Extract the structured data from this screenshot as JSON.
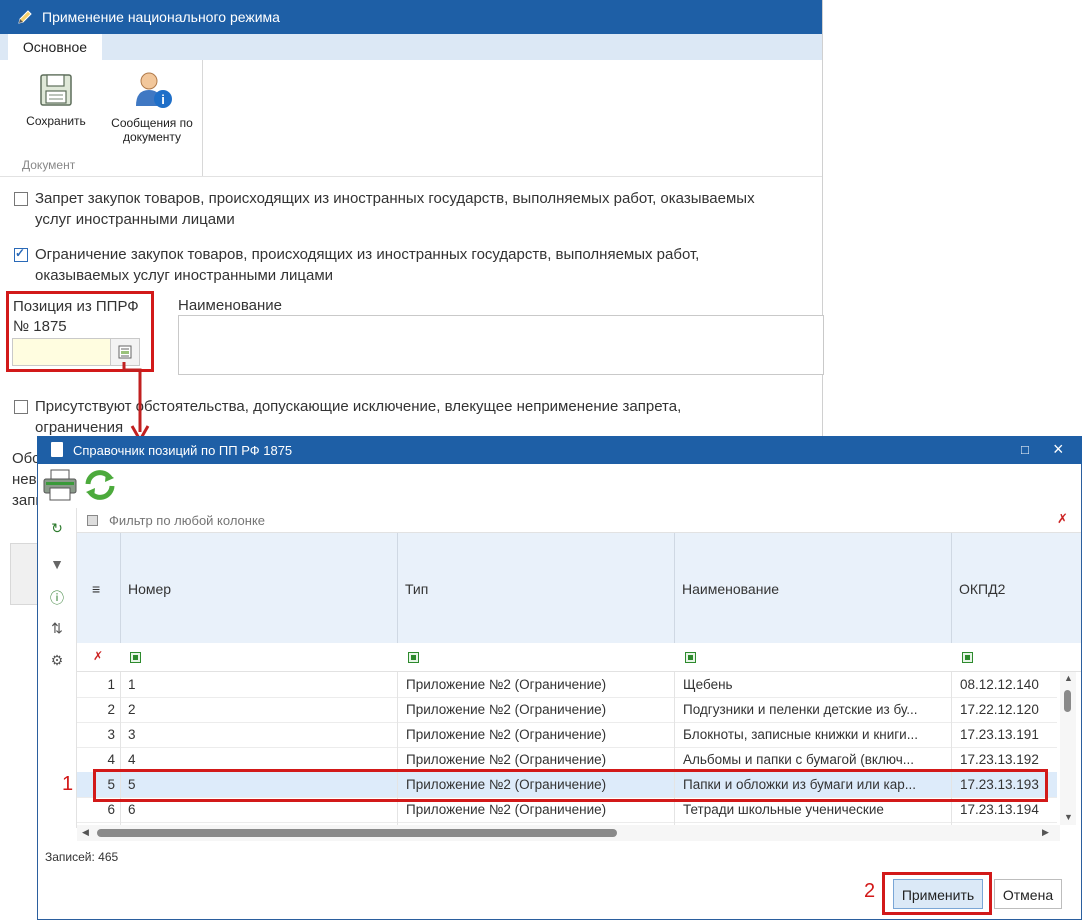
{
  "back_window": {
    "title": "Применение национального режима",
    "tabs": [
      {
        "label": "Основное"
      }
    ],
    "ribbon": {
      "save_label": "Сохранить",
      "messages_label_line1": "Сообщения по",
      "messages_label_line2": "документу",
      "group_label": "Документ"
    },
    "checkboxes": [
      {
        "checked": false,
        "line1": "Запрет закупок товаров, происходящих из иностранных государств, выполняемых работ, оказываемых",
        "line2": "услуг иностранными лицами"
      },
      {
        "checked": true,
        "line1": "Ограничение закупок товаров, происходящих из иностранных государств, выполняемых работ,",
        "line2": "оказываемых услуг иностранными лицами"
      },
      {
        "checked": false,
        "line1": "Присутствуют обстоятельства, допускающие исключение, влекущее неприменение запрета,",
        "line2": "ограничения"
      }
    ],
    "position_label_line1": "Позиция из ППРФ",
    "position_label_line2": "№ 1875",
    "position_value": "",
    "name_label": "Наименование",
    "name_value": "",
    "fragment_lines": [
      "Обс",
      "нев",
      "запи"
    ]
  },
  "dialog": {
    "title": "Справочник позиций по ПП РФ 1875",
    "filter_placeholder": "Фильтр по любой колонке",
    "columns": [
      "Номер",
      "Тип",
      "Наименование",
      "ОКПД2"
    ],
    "rows": [
      {
        "idx": "1",
        "num": "1",
        "type": "Приложение №2 (Ограничение)",
        "name": "Щебень",
        "okpd": "08.12.12.140"
      },
      {
        "idx": "2",
        "num": "2",
        "type": "Приложение №2 (Ограничение)",
        "name": "Подгузники и пеленки детские из бу...",
        "okpd": "17.22.12.120"
      },
      {
        "idx": "3",
        "num": "3",
        "type": "Приложение №2 (Ограничение)",
        "name": "Блокноты, записные книжки и книги...",
        "okpd": "17.23.13.191"
      },
      {
        "idx": "4",
        "num": "4",
        "type": "Приложение №2 (Ограничение)",
        "name": "Альбомы и папки с бумагой (включ...",
        "okpd": "17.23.13.192"
      },
      {
        "idx": "5",
        "num": "5",
        "type": "Приложение №2 (Ограничение)",
        "name": "Папки и обложки из бумаги или кар...",
        "okpd": "17.23.13.193",
        "selected": true
      },
      {
        "idx": "6",
        "num": "6",
        "type": "Приложение №2 (Ограничение)",
        "name": "Тетради школьные ученические",
        "okpd": "17.23.13.194"
      }
    ],
    "records_label": "Записей: 465",
    "apply_label": "Применить",
    "cancel_label": "Отмена"
  },
  "annotations": {
    "mark1": "1",
    "mark2": "2",
    "color": "#d21919"
  },
  "colors": {
    "title_bar": "#1e5fa6",
    "selected_row": "#ddebfa",
    "header_bg": "#e9f1fa"
  }
}
